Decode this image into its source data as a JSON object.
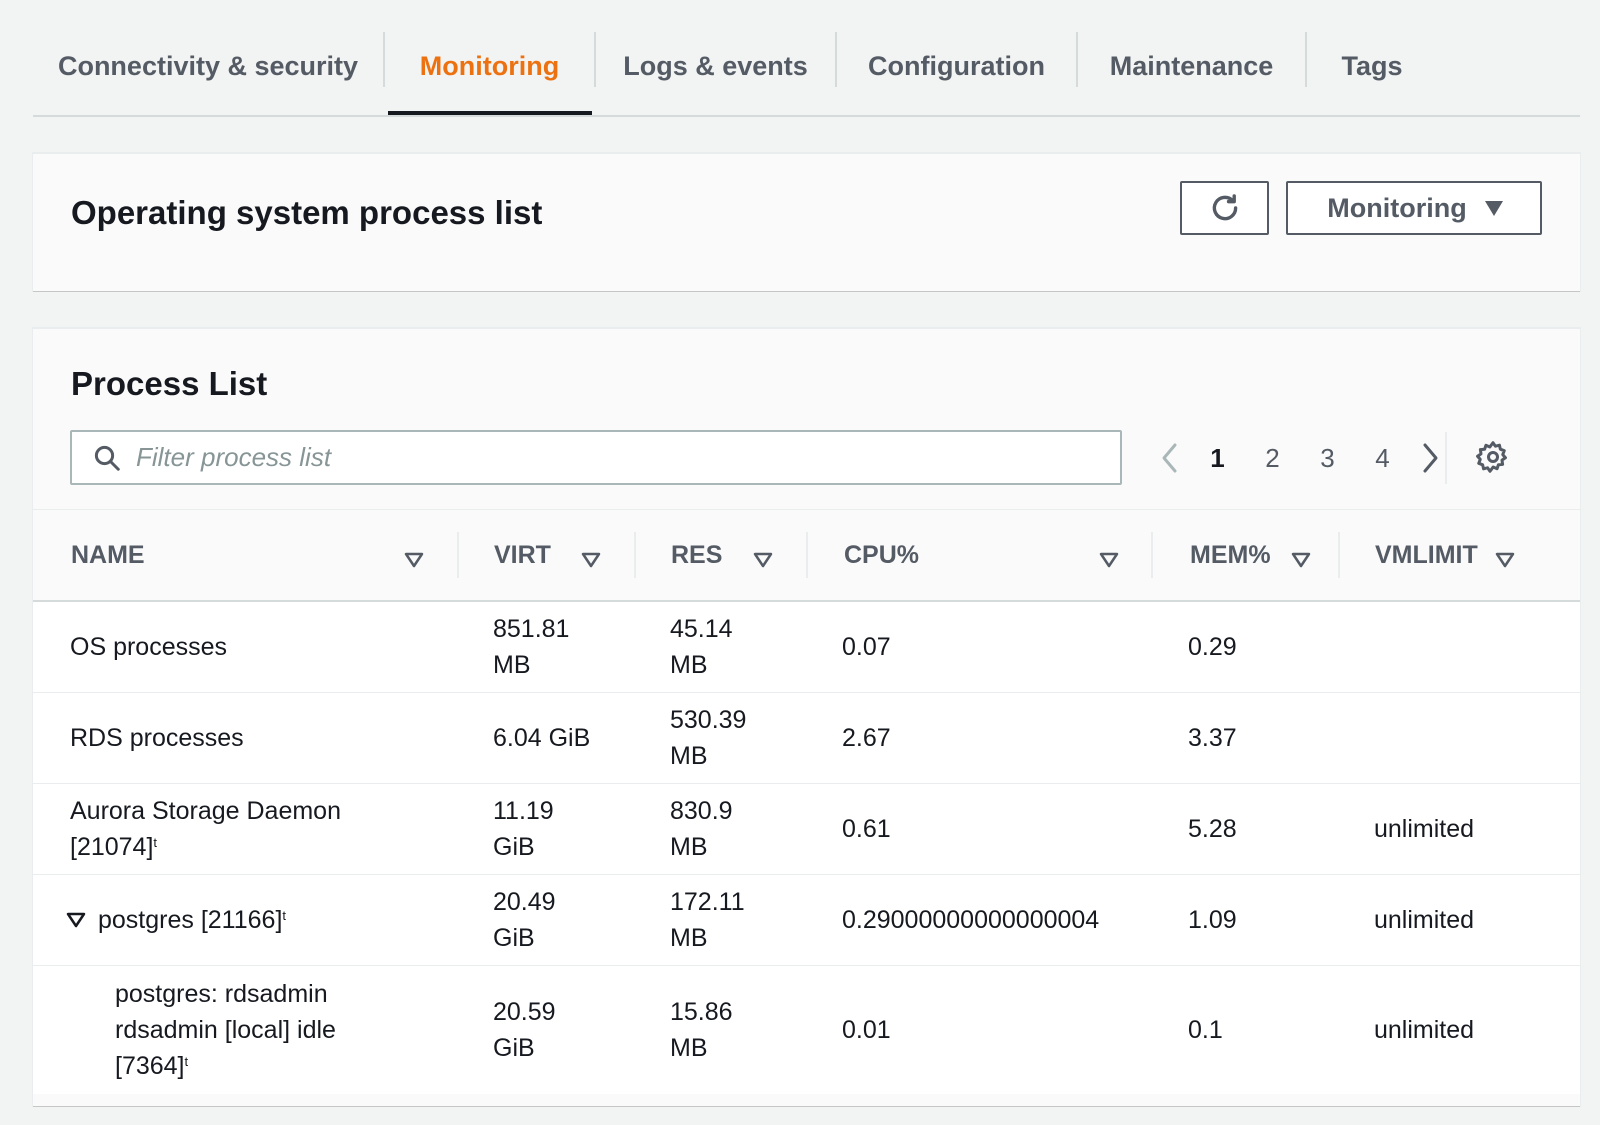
{
  "tabs": [
    {
      "label": "Connectivity & security"
    },
    {
      "label": "Monitoring"
    },
    {
      "label": "Logs & events"
    },
    {
      "label": "Configuration"
    },
    {
      "label": "Maintenance"
    },
    {
      "label": "Tags"
    }
  ],
  "active_tab": "Monitoring",
  "os_panel": {
    "title": "Operating system process list",
    "refresh_icon": "refresh-icon",
    "monitoring_button": "Monitoring"
  },
  "process_panel": {
    "title": "Process List",
    "search_placeholder": "Filter process list",
    "pages": [
      "1",
      "2",
      "3",
      "4"
    ],
    "current_page": "1"
  },
  "table": {
    "headers": [
      "NAME",
      "VIRT",
      "RES",
      "CPU%",
      "MEM%",
      "VMLIMIT"
    ],
    "rows": [
      {
        "name": "OS processes",
        "virt_1": "851.81",
        "virt_2": "MB",
        "res_1": "45.14",
        "res_2": "MB",
        "cpu": "0.07",
        "mem": "0.29",
        "vmlimit": ""
      },
      {
        "name": "RDS processes",
        "virt": "6.04 GiB",
        "res_1": "530.39",
        "res_2": "MB",
        "cpu": "2.67",
        "mem": "3.37",
        "vmlimit": ""
      },
      {
        "name_1": "Aurora Storage Daemon",
        "name_2": "[21074]",
        "name_sup": "t",
        "virt_1": "11.19",
        "virt_2": "GiB",
        "res_1": "830.9",
        "res_2": "MB",
        "cpu": "0.61",
        "mem": "5.28",
        "vmlimit": "unlimited"
      },
      {
        "name": "postgres [21166]",
        "name_sup": "t",
        "virt_1": "20.49",
        "virt_2": "GiB",
        "res_1": "172.11",
        "res_2": "MB",
        "cpu": "0.29000000000000004",
        "mem": "1.09",
        "vmlimit": "unlimited"
      },
      {
        "name_1": "postgres: rdsadmin",
        "name_2": "rdsadmin [local] idle",
        "name_3": "[7364]",
        "name_sup": "t",
        "virt_1": "20.59",
        "virt_2": "GiB",
        "res_1": "15.86",
        "res_2": "MB",
        "cpu": "0.01",
        "mem": "0.1",
        "vmlimit": "unlimited"
      }
    ]
  },
  "colors": {
    "accent": "#ec7211",
    "text": "#16191f",
    "muted": "#545b64",
    "background": "#f2f3f3"
  }
}
